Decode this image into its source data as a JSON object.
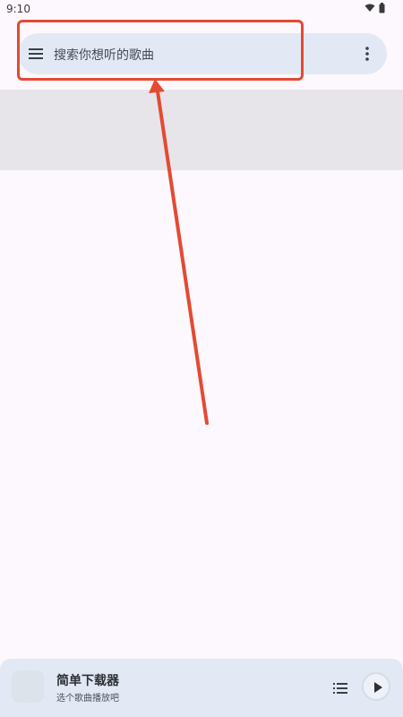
{
  "status_bar": {
    "time": "9:10",
    "icons": [
      "wifi-icon",
      "battery-icon"
    ]
  },
  "search": {
    "placeholder": "搜索你想听的歌曲",
    "menu_icon": "hamburger-menu-icon",
    "more_icon": "more-vert-icon"
  },
  "annotation": {
    "box_color": "#e44a32",
    "arrow_color": "#e44a32"
  },
  "mini_player": {
    "title": "简单下载器",
    "subtitle": "选个歌曲播放吧",
    "playlist_icon": "playlist-icon",
    "play_icon": "play-icon"
  },
  "colors": {
    "background": "#fdf8fe",
    "search_bar": "#e2e9f5",
    "band": "#e7e5ea",
    "player": "#e2e9f5"
  }
}
